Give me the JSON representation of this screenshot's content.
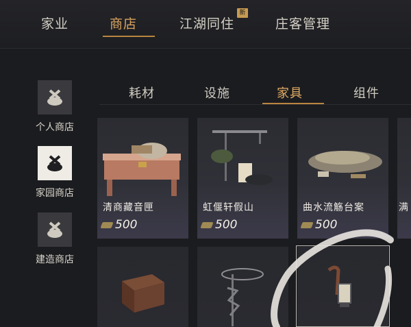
{
  "top_tabs": [
    {
      "label": "家业"
    },
    {
      "label": "商店"
    },
    {
      "label": "江湖同住"
    },
    {
      "label": "庄客管理"
    }
  ],
  "new_badge": "新",
  "side_menu": [
    {
      "label": "个人商店",
      "icon": "bag-icon"
    },
    {
      "label": "家园商店",
      "icon": "bag-icon"
    },
    {
      "label": "建造商店",
      "icon": "bag-icon"
    }
  ],
  "sub_tabs": [
    {
      "label": "耗材"
    },
    {
      "label": "设施"
    },
    {
      "label": "家具"
    },
    {
      "label": "组件"
    }
  ],
  "items": [
    {
      "name": "清商藏音匣",
      "price": "500",
      "icon": "music-box"
    },
    {
      "name": "虹偃轩假山",
      "price": "500",
      "icon": "rockery"
    },
    {
      "name": "曲水流觞台案",
      "price": "500",
      "icon": "stone-table"
    },
    {
      "name": "满",
      "price": "",
      "icon": "partial-item"
    },
    {
      "name": "",
      "price": "",
      "icon": "wooden-chest"
    },
    {
      "name": "",
      "price": "",
      "icon": "hanging-rack"
    },
    {
      "name": "",
      "price": "",
      "icon": "lantern-post"
    }
  ],
  "colors": {
    "accent": "#d9a35f",
    "background": "#1b1c1f"
  }
}
